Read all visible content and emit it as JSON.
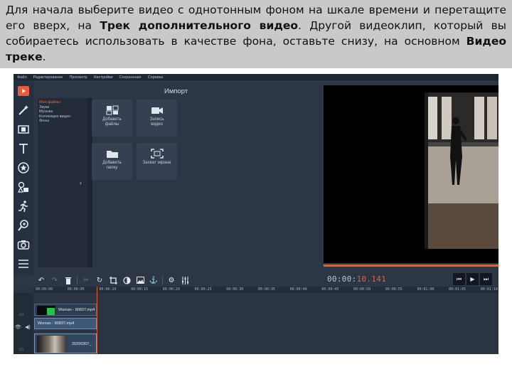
{
  "caption": {
    "part1": "Для начала выберите видео с однотонным фоном на шкале времени и перетащите его вверх, на ",
    "bold1": "Трек дополнительного видео",
    "part2": ". Другой видеоклип, который вы собираетесь использовать в качестве фона, оставьте снизу, на основном ",
    "bold2": "Видео треке",
    "part3": "."
  },
  "menu": [
    "Файл",
    "Редактирование",
    "Просмотр",
    "Настройки",
    "Сохранение",
    "Справка"
  ],
  "import": {
    "title": "Импорт",
    "categories": [
      "Мои файлы",
      "Звуки",
      "Музыка",
      "Коллекция видео",
      "Фоны"
    ],
    "tiles": {
      "add_files": "Добавить\nфайлы",
      "record_video": "Запись\nвидео",
      "add_folder": "Добавить\nпапку",
      "screen_capture": "Захват экрана"
    }
  },
  "player": {
    "timecode_main": "00:00:",
    "timecode_accent": "10.141",
    "progress": 1.0
  },
  "timeline": {
    "ticks": [
      "00:00:00",
      "00:00:05",
      "00:00:10",
      "00:00:15",
      "00:00:20",
      "00:00:25",
      "00:00:30",
      "00:00:35",
      "00:00:40",
      "00:00:45",
      "00:00:50",
      "00:00:55",
      "00:01:00",
      "00:01:05",
      "00:01:10"
    ],
    "overlay_clip_label": "Woman - 80837.mp4",
    "video_clip_label": "Woman - 80837.mp4",
    "background_clip_label": "20200307_"
  },
  "colors": {
    "accent": "#e2623c",
    "panel": "#2c3645",
    "clip_selected": "#3e5878"
  }
}
